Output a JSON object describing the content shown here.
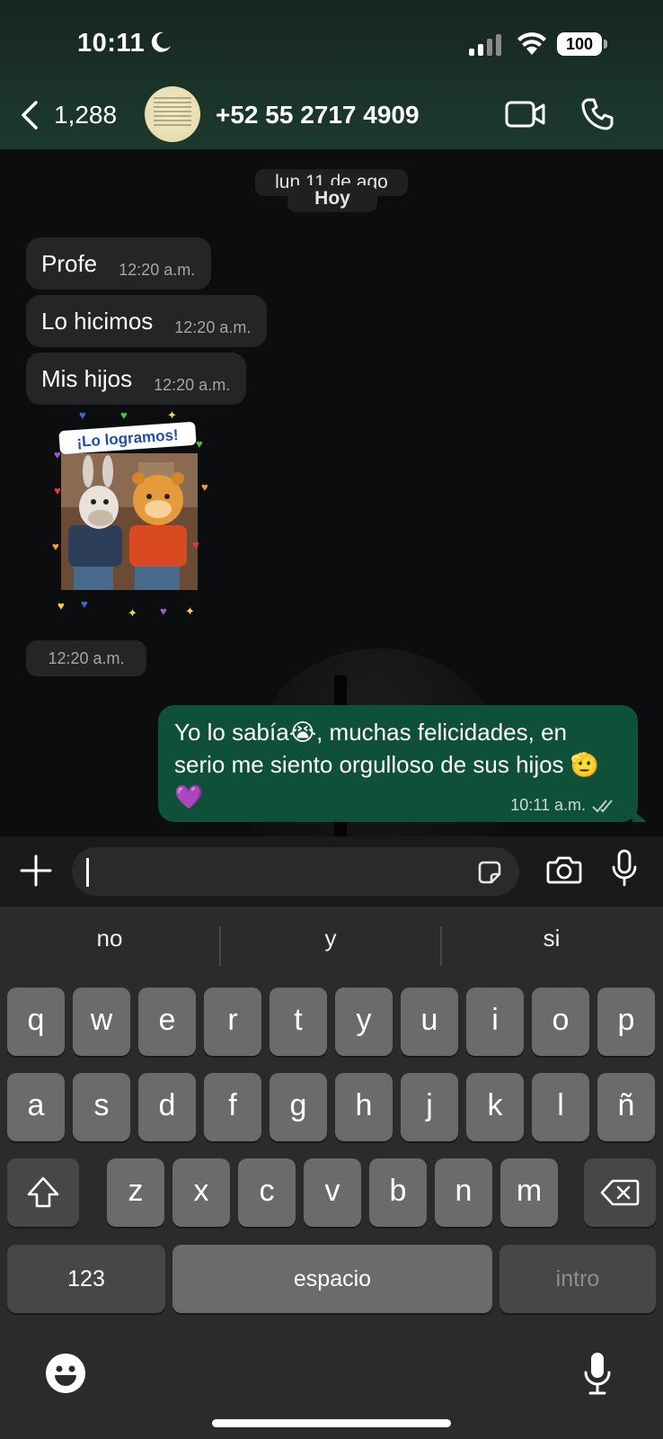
{
  "status_bar": {
    "time": "10:11",
    "battery": "100"
  },
  "header": {
    "back_count": "1,288",
    "contact": "+52 55 2717 4909"
  },
  "chat": {
    "date_pill": "lun 11 de ago",
    "today_pill": "Hoy",
    "incoming": [
      {
        "text": "Profe",
        "time": "12:20 a.m."
      },
      {
        "text": "Lo hicimos",
        "time": "12:20 a.m."
      },
      {
        "text": "Mis hijos",
        "time": "12:20 a.m."
      }
    ],
    "sticker": {
      "banner": "¡Lo logramos!",
      "time": "12:20 a.m."
    },
    "outgoing": {
      "text": "Yo lo sabía😭, muchas felicidades, en serio me siento orgulloso de sus hijos 🫡💜",
      "time": "10:11 a.m."
    }
  },
  "input": {
    "placeholder": ""
  },
  "keyboard": {
    "suggestions": [
      "no",
      "y",
      "si"
    ],
    "row1": [
      "q",
      "w",
      "e",
      "r",
      "t",
      "y",
      "u",
      "i",
      "o",
      "p"
    ],
    "row2": [
      "a",
      "s",
      "d",
      "f",
      "g",
      "h",
      "j",
      "k",
      "l",
      "ñ"
    ],
    "row3": [
      "z",
      "x",
      "c",
      "v",
      "b",
      "n",
      "m"
    ],
    "numbers_key": "123",
    "space_key": "espacio",
    "return_key": "intro"
  },
  "colors": {
    "outgoing_bubble": "#0f5138",
    "incoming_bubble": "#242527",
    "header": "#1c3a2e"
  }
}
